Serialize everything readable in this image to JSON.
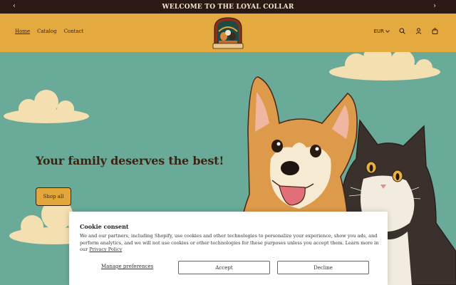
{
  "announcement": {
    "text": "WELCOME TO THE LOYAL COLLAR",
    "prev_icon": "chevron-left-icon",
    "next_icon": "chevron-right-icon"
  },
  "header": {
    "nav": [
      {
        "label": "Home",
        "active": true
      },
      {
        "label": "Catalog",
        "active": false
      },
      {
        "label": "Contact",
        "active": false
      }
    ],
    "logo_text": "THE LOYAL COLLAR",
    "currency": "EUR",
    "icons": [
      "search-icon",
      "account-icon",
      "cart-icon"
    ],
    "background": "#e4a93f"
  },
  "hero": {
    "headline": "Your family deserves the best!",
    "cta_label": "Shop all",
    "background": "#6aaa98"
  },
  "cookie": {
    "title": "Cookie consent",
    "body": "We and our partners, including Shopify, use cookies and other technologies to personalize your experience, show you ads, and perform analytics, and we will not use cookies or other technologies for these purposes unless you accept them. Learn more in our",
    "policy_link": "Privacy Policy",
    "manage_label": "Manage preferences",
    "accept_label": "Accept",
    "decline_label": "Decline"
  },
  "colors": {
    "announcement_bg": "#2b1a14",
    "accent": "#e3a63a",
    "text_dark": "#3a2414"
  }
}
